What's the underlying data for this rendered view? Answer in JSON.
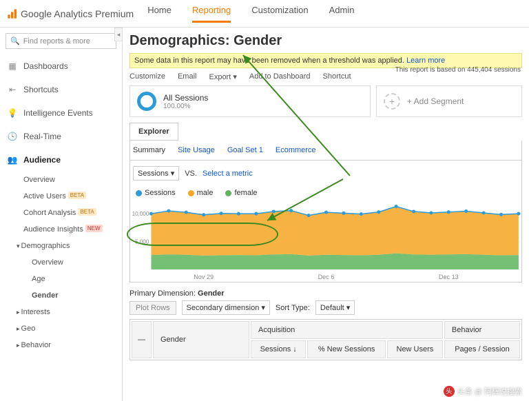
{
  "brand": "Google Analytics Premium",
  "topnav": {
    "home": "Home",
    "reporting": "Reporting",
    "customization": "Customization",
    "admin": "Admin"
  },
  "search": {
    "placeholder": "Find reports & more"
  },
  "sidebar": {
    "dashboards": "Dashboards",
    "shortcuts": "Shortcuts",
    "intelligence": "Intelligence Events",
    "realtime": "Real-Time",
    "audience": "Audience",
    "items": {
      "overview": "Overview",
      "active": "Active Users",
      "cohort": "Cohort Analysis",
      "insights": "Audience Insights",
      "demographics": "Demographics",
      "demo_overview": "Overview",
      "age": "Age",
      "gender": "Gender",
      "interests": "Interests",
      "geo": "Geo",
      "behavior": "Behavior"
    },
    "tags": {
      "beta": "BETA",
      "new": "NEW"
    }
  },
  "page": {
    "title": "Demographics: Gender",
    "banner_prefix": "Some data in this report may have been removed when a threshold was applied. ",
    "banner_link": "Learn more",
    "report_meta": "This report is based on 445,404 sessions"
  },
  "actions": {
    "customize": "Customize",
    "email": "Email",
    "export": "Export ▾",
    "addto": "Add to Dashboard",
    "shortcut": "Shortcut"
  },
  "segments": {
    "all_title": "All Sessions",
    "all_pct": "100.00%",
    "add": "+ Add Segment"
  },
  "explorer": {
    "tab": "Explorer",
    "summary": "Summary",
    "siteusage": "Site Usage",
    "goal1": "Goal Set 1",
    "ecom": "Ecommerce",
    "metric_btn": "Sessions  ▾",
    "vs": "VS.",
    "select_metric": "Select a metric"
  },
  "legend": {
    "s": "Sessions",
    "m": "male",
    "f": "female"
  },
  "chart_data": {
    "type": "area",
    "x_ticks": [
      "Nov 29",
      "Dec 6",
      "Dec 13"
    ],
    "y_ticks": [
      5000,
      10000
    ],
    "series": [
      {
        "name": "male",
        "color": "#f5a623",
        "values": [
          7400,
          7800,
          7600,
          7300,
          7500,
          7400,
          7450,
          7700,
          7800,
          7200,
          7600,
          7500,
          7400,
          7650,
          8400,
          7700,
          7500,
          7600,
          7700,
          7500,
          7300,
          7400
        ]
      },
      {
        "name": "female",
        "color": "#5eb55e",
        "values": [
          2600,
          2700,
          2650,
          2500,
          2550,
          2600,
          2550,
          2700,
          2750,
          2500,
          2650,
          2600,
          2550,
          2650,
          2900,
          2700,
          2650,
          2700,
          2750,
          2650,
          2550,
          2600
        ]
      }
    ],
    "line": {
      "name": "Sessions",
      "color": "#2b9cd8",
      "values": [
        10000,
        10500,
        10250,
        9800,
        10050,
        10000,
        10000,
        10400,
        10550,
        9700,
        10250,
        10100,
        9950,
        10300,
        11300,
        10400,
        10150,
        10300,
        10450,
        10150,
        9850,
        10000
      ]
    },
    "ylim": [
      0,
      12000
    ]
  },
  "dimension": {
    "label": "Primary Dimension:",
    "value": "Gender"
  },
  "controls": {
    "plot": "Plot Rows",
    "secdim": "Secondary dimension ▾",
    "sort_label": "Sort Type:",
    "sort_val": "Default ▾"
  },
  "table": {
    "col_gender": "Gender",
    "grp_acq": "Acquisition",
    "grp_beh": "Behavior",
    "c1": "Sessions",
    "c2": "% New Sessions",
    "c3": "New Users",
    "c4": "Pages / Session",
    "arrow": "↓"
  },
  "watermark": "头条 @ 阿辉说搜索"
}
